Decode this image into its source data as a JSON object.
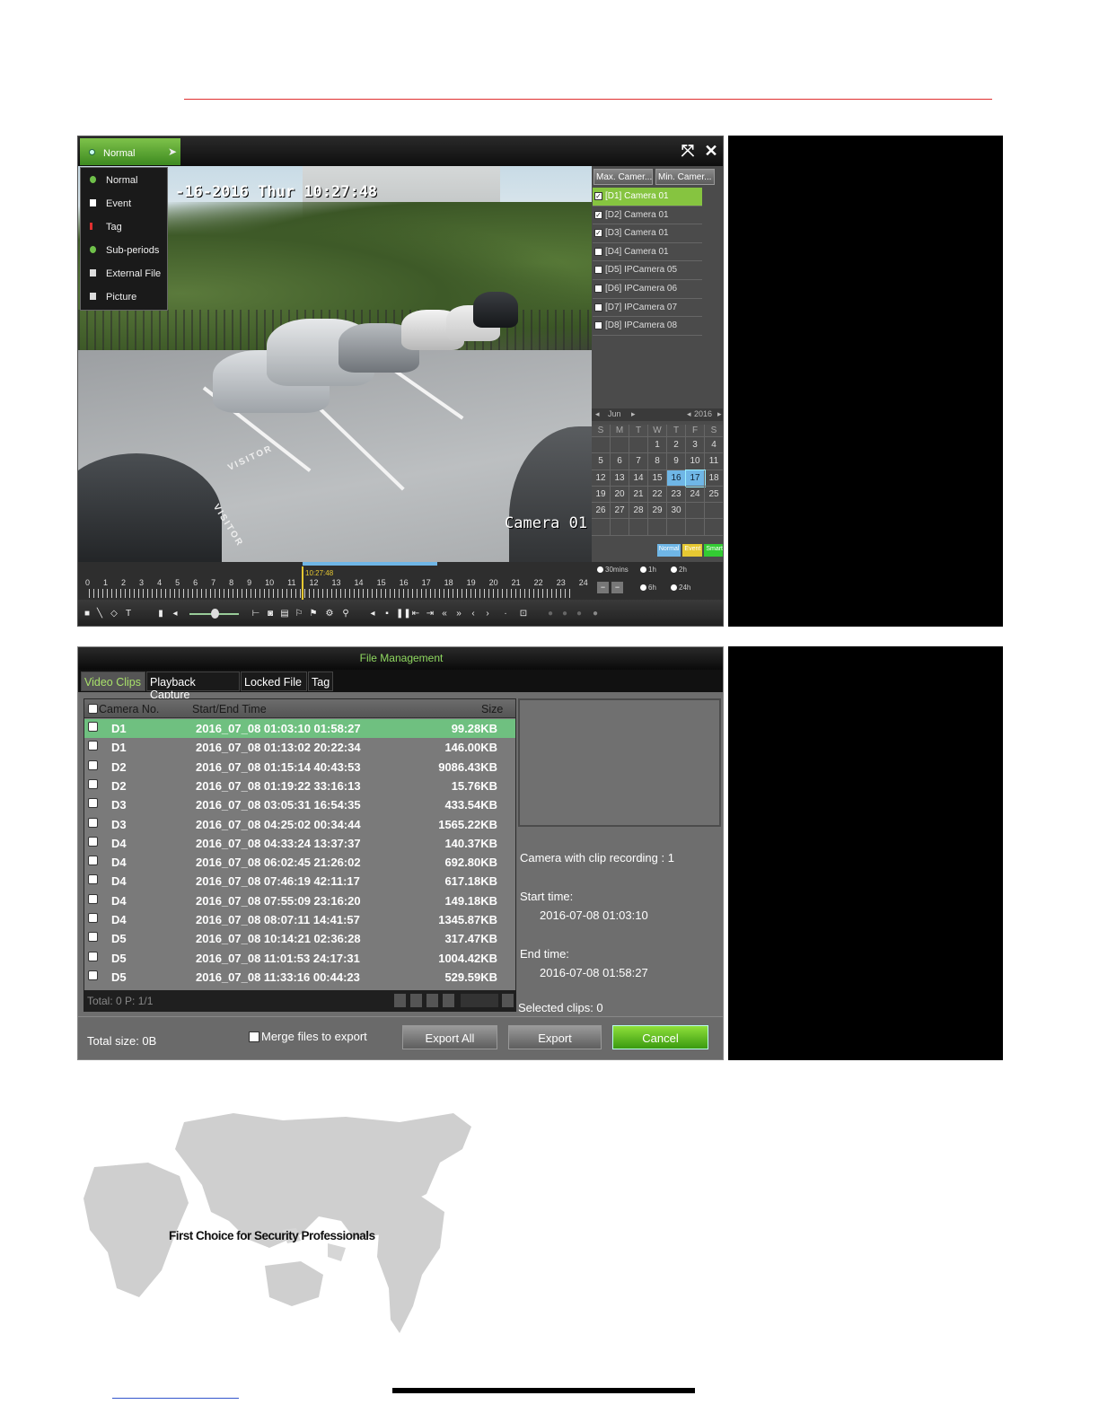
{
  "playback": {
    "mode_button": "Normal",
    "menu_items": [
      {
        "label": "Normal",
        "icon": "normal-dot-icon",
        "color": "#6fc04a"
      },
      {
        "label": "Event",
        "icon": "event-icon",
        "color": "#ffffff"
      },
      {
        "label": "Tag",
        "icon": "tag-icon",
        "color": "#e03030"
      },
      {
        "label": "Sub-periods",
        "icon": "sub-periods-icon",
        "color": "#6fc04a"
      },
      {
        "label": "External File",
        "icon": "external-file-icon",
        "color": "#dddddd"
      },
      {
        "label": "Picture",
        "icon": "picture-icon",
        "color": "#dddddd"
      }
    ],
    "osd_time": "-16-2016 Thur 10:27:48",
    "osd_camera": "Camera 01",
    "ground_text_1": "VISITOR",
    "ground_text_2": "VISITOR",
    "max_camera": "Max. Camer...",
    "min_camera": "Min. Camer...",
    "cameras": [
      {
        "label": "[D1] Camera 01",
        "checked": true,
        "selected": true
      },
      {
        "label": "[D2] Camera 01",
        "checked": true,
        "selected": false
      },
      {
        "label": "[D3] Camera 01",
        "checked": true,
        "selected": false
      },
      {
        "label": "[D4] Camera 01",
        "checked": false,
        "selected": false
      },
      {
        "label": "[D5] IPCamera 05",
        "checked": false,
        "selected": false
      },
      {
        "label": "[D6] IPCamera 06",
        "checked": false,
        "selected": false
      },
      {
        "label": "[D7] IPCamera 07",
        "checked": false,
        "selected": false
      },
      {
        "label": "[D8] IPCamera 08",
        "checked": false,
        "selected": false
      }
    ],
    "calendar": {
      "month": "Jun",
      "year": "2016",
      "weekdays": [
        "S",
        "M",
        "T",
        "W",
        "T",
        "F",
        "S"
      ],
      "weeks": [
        [
          "",
          "",
          "",
          "1",
          "2",
          "3",
          "4"
        ],
        [
          "5",
          "6",
          "7",
          "8",
          "9",
          "10",
          "11"
        ],
        [
          "12",
          "13",
          "14",
          "15",
          "16",
          "17",
          "18"
        ],
        [
          "19",
          "20",
          "21",
          "22",
          "23",
          "24",
          "25"
        ],
        [
          "26",
          "27",
          "28",
          "29",
          "30",
          "",
          ""
        ],
        [
          "",
          "",
          "",
          "",
          "",
          "",
          ""
        ]
      ],
      "highlighted": [
        "16",
        "17"
      ]
    },
    "legend": [
      {
        "label": "Normal",
        "color": "#6fb6e6"
      },
      {
        "label": "Event",
        "color": "#e6c832"
      },
      {
        "label": "Smart",
        "color": "#33cc33"
      }
    ],
    "timeline": {
      "hours": [
        "0",
        "1",
        "2",
        "3",
        "4",
        "5",
        "6",
        "7",
        "8",
        "9",
        "10",
        "11",
        "12",
        "13",
        "14",
        "15",
        "16",
        "17",
        "18",
        "19",
        "20",
        "21",
        "22",
        "23",
        "24"
      ],
      "cursor_time": "10:27:48"
    },
    "time_scales": [
      {
        "label": "30mins"
      },
      {
        "label": "1h"
      },
      {
        "label": "2h"
      },
      {
        "label": "6h"
      },
      {
        "label": "24h",
        "selected": true
      }
    ]
  },
  "file_management": {
    "title": "File Management",
    "tabs": [
      "Video Clips",
      "Playback Capture",
      "Locked File",
      "Tag"
    ],
    "active_tab": 0,
    "columns": [
      "Camera No.",
      "Start/End Time",
      "Size"
    ],
    "rows": [
      {
        "cam": "D1",
        "time": "2016_07_08 01:03:10 01:58:27",
        "size": "99.28KB",
        "selected": true
      },
      {
        "cam": "D1",
        "time": "2016_07_08 01:13:02 20:22:34",
        "size": "146.00KB"
      },
      {
        "cam": "D2",
        "time": "2016_07_08 01:15:14 40:43:53",
        "size": "9086.43KB"
      },
      {
        "cam": "D2",
        "time": "2016_07_08 01:19:22 33:16:13",
        "size": "15.76KB"
      },
      {
        "cam": "D3",
        "time": "2016_07_08 03:05:31 16:54:35",
        "size": "433.54KB"
      },
      {
        "cam": "D3",
        "time": "2016_07_08 04:25:02 00:34:44",
        "size": "1565.22KB"
      },
      {
        "cam": "D4",
        "time": "2016_07_08 04:33:24 13:37:37",
        "size": "140.37KB"
      },
      {
        "cam": "D4",
        "time": "2016_07_08 06:02:45 21:26:02",
        "size": "692.80KB"
      },
      {
        "cam": "D4",
        "time": "2016_07_08 07:46:19 42:11:17",
        "size": "617.18KB"
      },
      {
        "cam": "D4",
        "time": "2016_07_08 07:55:09 23:16:20",
        "size": "149.18KB"
      },
      {
        "cam": "D4",
        "time": "2016_07_08 08:07:11 14:41:57",
        "size": "1345.87KB"
      },
      {
        "cam": "D5",
        "time": "2016_07_08 10:14:21 02:36:28",
        "size": "317.47KB"
      },
      {
        "cam": "D5",
        "time": "2016_07_08 11:01:53 24:17:31",
        "size": "1004.42KB"
      },
      {
        "cam": "D5",
        "time": "2016_07_08 11:33:16 00:44:23",
        "size": "529.59KB"
      }
    ],
    "pager": "Total: 0  P: 1/1",
    "camera_with_clip": "Camera with clip recording : 1",
    "start_label": "Start time:",
    "start_value": "2016-07-08 01:03:10",
    "end_label": "End time:",
    "end_value": "2016-07-08 01:58:27",
    "selected_clips": "Selected clips: 0",
    "total_size": "Total size: 0B",
    "merge_label": "Merge files to export",
    "buttons": {
      "export_all": "Export All",
      "export": "Export",
      "cancel": "Cancel"
    }
  },
  "tagline": "First Choice for Security Professionals",
  "colors": {
    "accent_green": "#86c440",
    "rule_red": "#e03030",
    "selection_green": "#6fc080"
  }
}
